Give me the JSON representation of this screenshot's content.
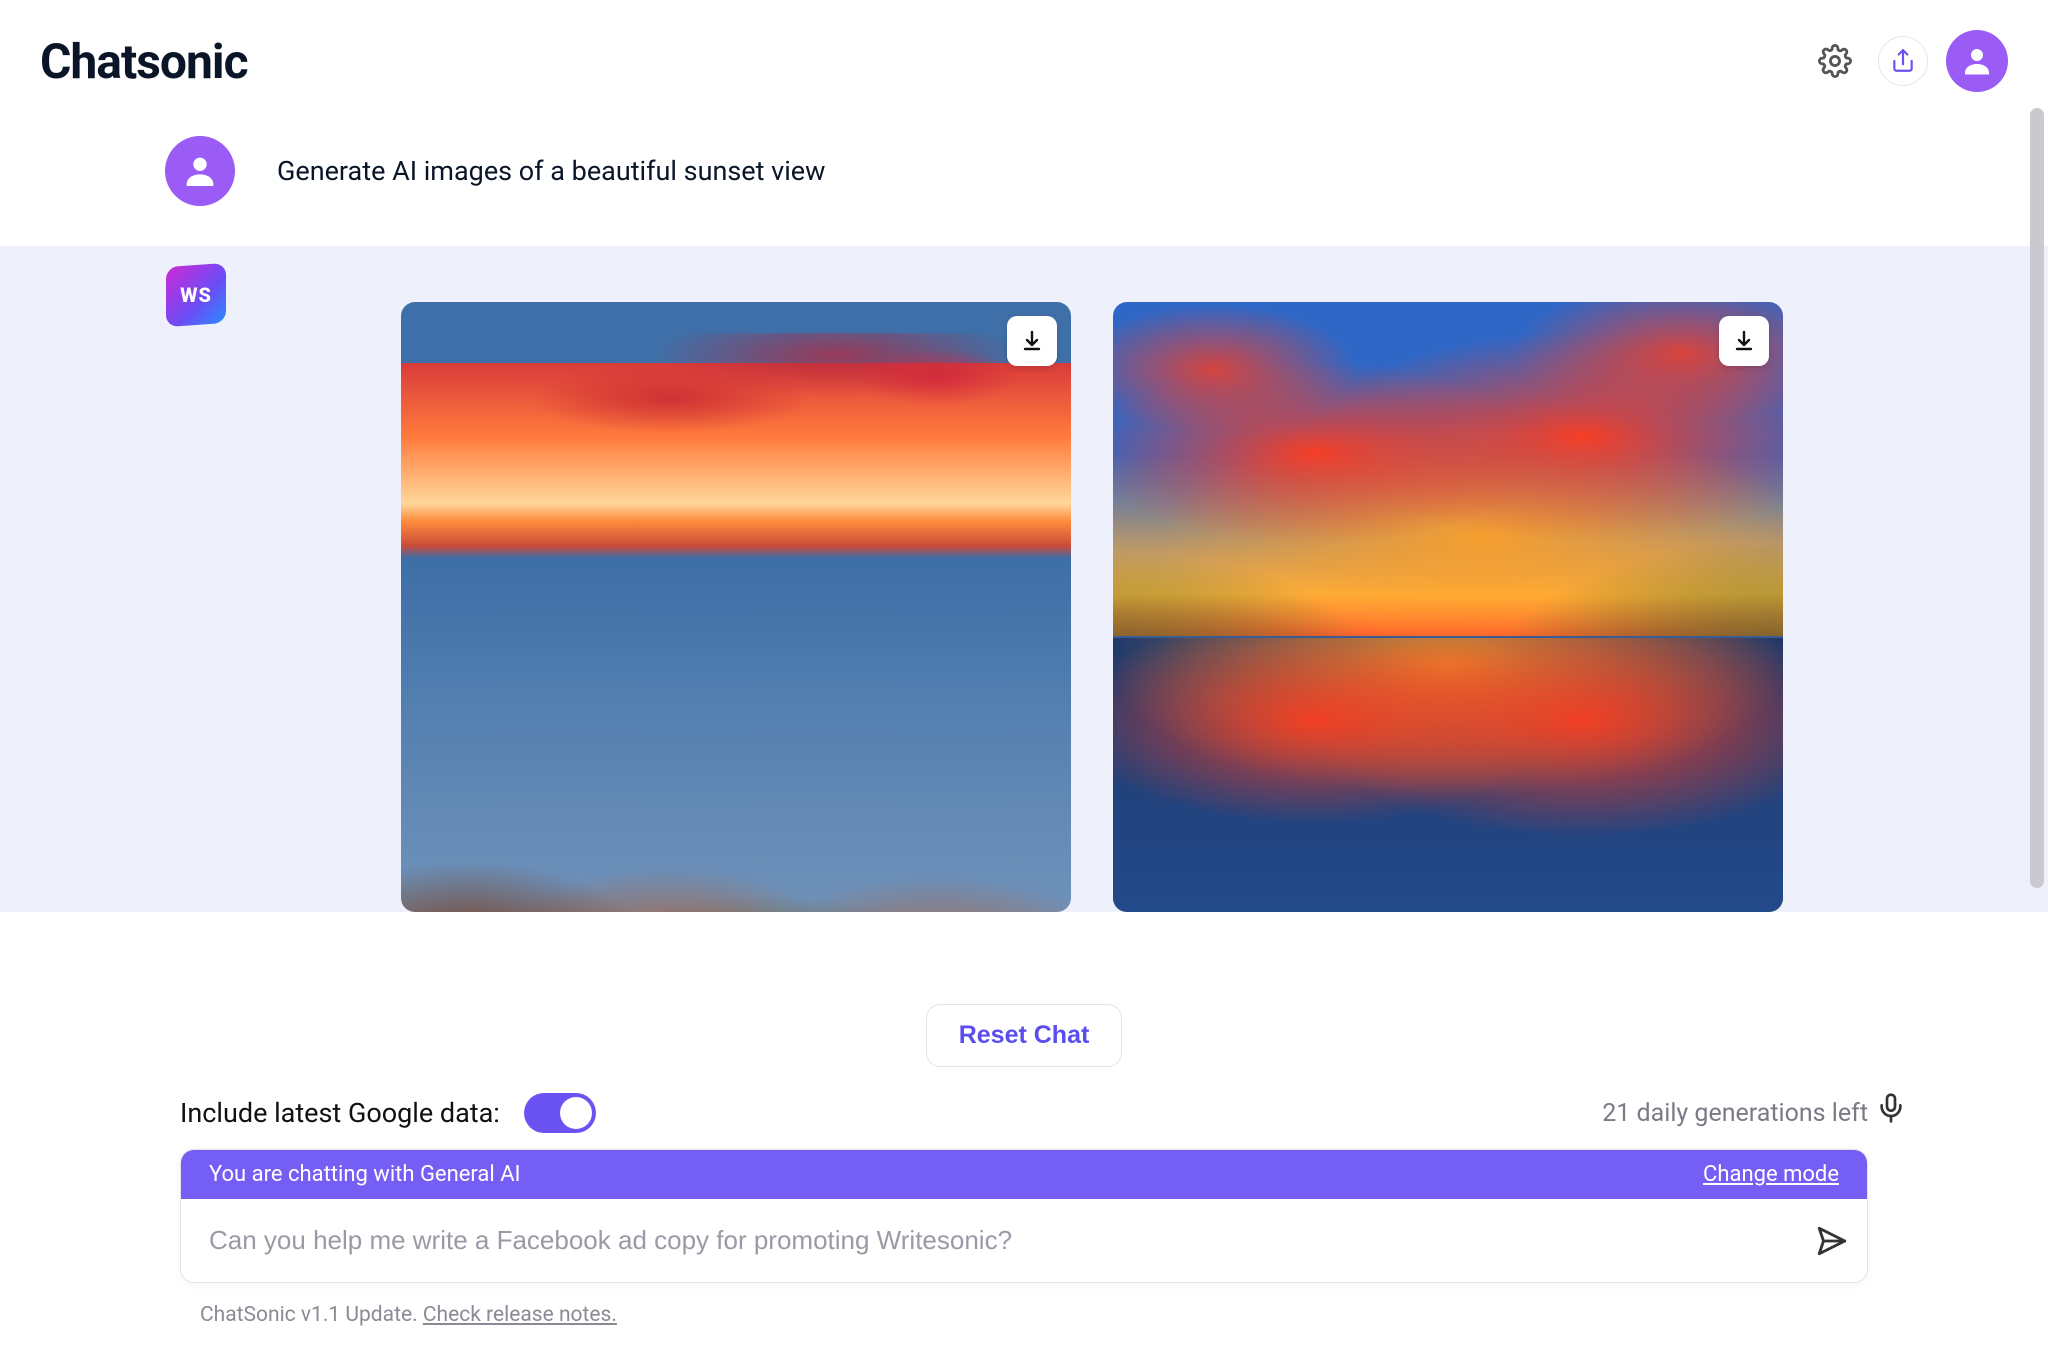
{
  "header": {
    "logo": "Chatsonic"
  },
  "prompt": {
    "text": "Generate AI images of a beautiful sunset view"
  },
  "bot": {
    "badge": "WS"
  },
  "controls": {
    "reset_label": "Reset Chat",
    "google_label": "Include latest Google data:",
    "generations_left": "21 daily generations left",
    "mode_bar_text": "You are chatting with General AI",
    "change_mode_label": "Change mode",
    "input_placeholder": "Can you help me write a Facebook ad copy for promoting Writesonic?"
  },
  "footer": {
    "update_text": "ChatSonic v1.1 Update. ",
    "release_notes_label": "Check release notes."
  }
}
